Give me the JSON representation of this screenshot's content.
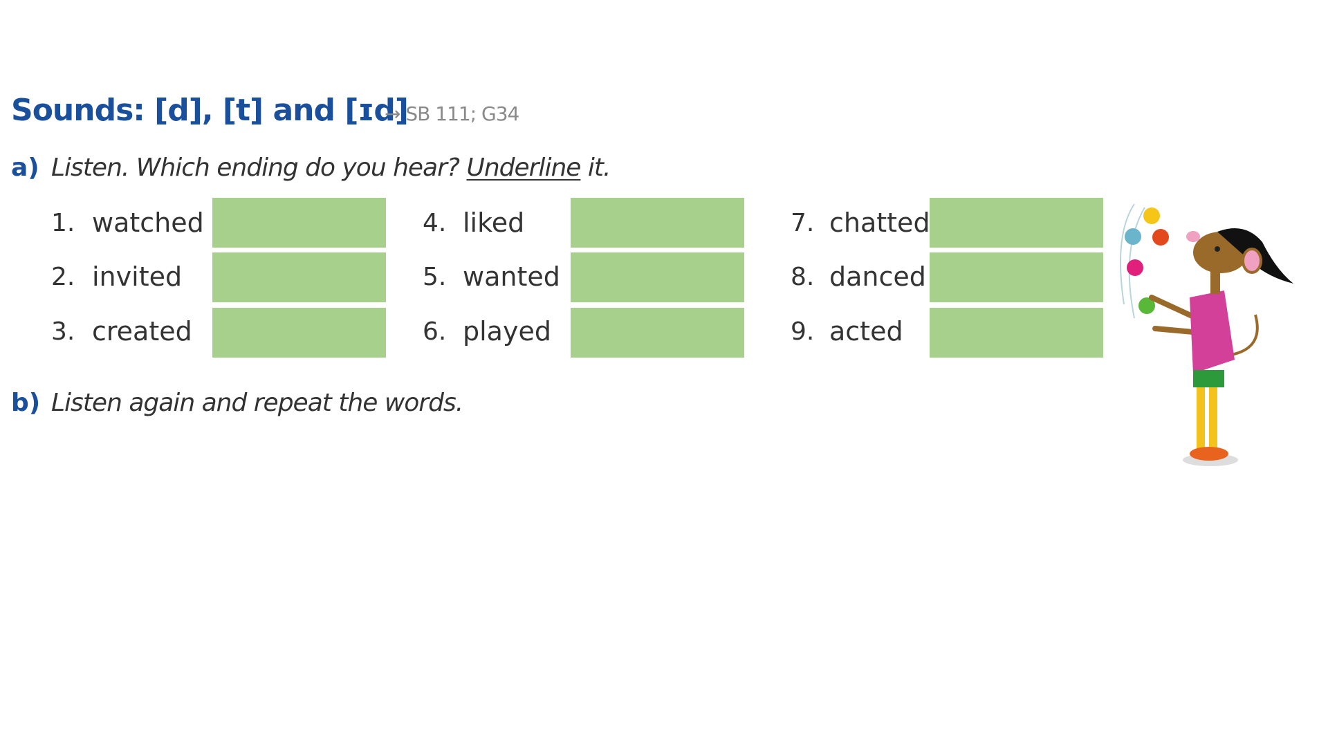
{
  "title": "Sounds: [d], [t] and [ɪd]",
  "reference": {
    "arrow_icon": "arrow-right-icon",
    "arrow": "→",
    "text": "SB 111; G34"
  },
  "task_a": {
    "label": "a)",
    "text_before": "Listen. Which ending do you hear? ",
    "underlined": "Underline",
    "text_after": " it."
  },
  "items": [
    {
      "number": "1.",
      "word": "watched"
    },
    {
      "number": "2.",
      "word": "invited"
    },
    {
      "number": "3.",
      "word": "created"
    },
    {
      "number": "4.",
      "word": "liked"
    },
    {
      "number": "5.",
      "word": "wanted"
    },
    {
      "number": "6.",
      "word": "played"
    },
    {
      "number": "7.",
      "word": "chatted"
    },
    {
      "number": "8.",
      "word": "danced"
    },
    {
      "number": "9.",
      "word": "acted"
    }
  ],
  "task_b": {
    "label": "b)",
    "text": "Listen again and repeat the words."
  },
  "colors": {
    "heading": "#1a4f9c",
    "answer_box": "#a8d08d"
  },
  "illustration": "juggling-mouse-illustration"
}
